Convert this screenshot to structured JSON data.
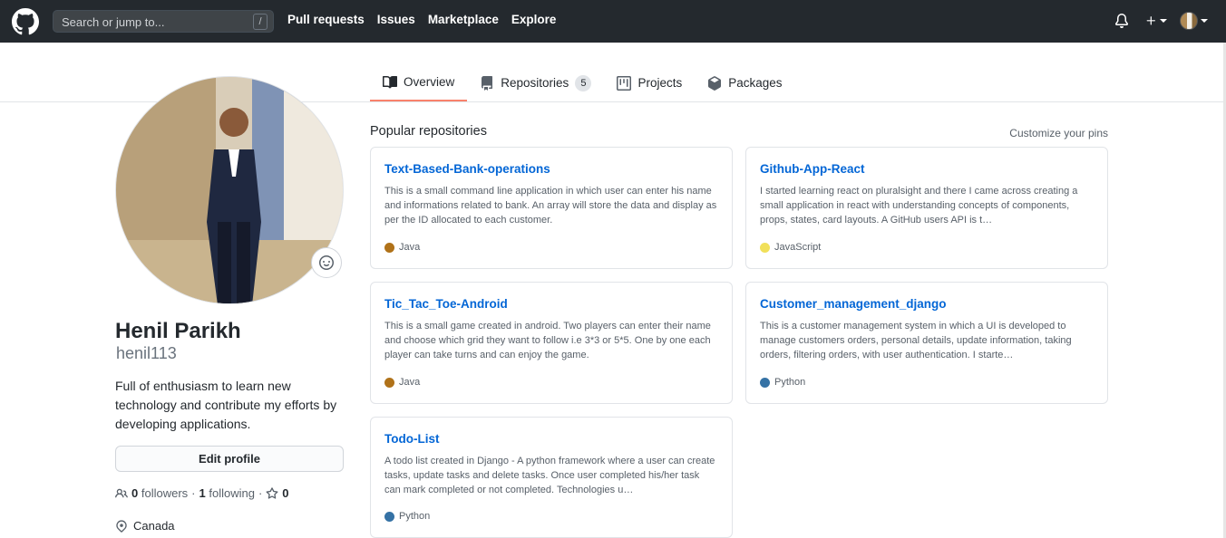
{
  "header": {
    "search_placeholder": "Search or jump to...",
    "search_shortcut": "/",
    "nav": [
      "Pull requests",
      "Issues",
      "Marketplace",
      "Explore"
    ]
  },
  "tabs": [
    {
      "label": "Overview",
      "icon": "book-icon",
      "active": true
    },
    {
      "label": "Repositories",
      "icon": "repo-icon",
      "count": "5"
    },
    {
      "label": "Projects",
      "icon": "project-icon"
    },
    {
      "label": "Packages",
      "icon": "package-icon"
    }
  ],
  "profile": {
    "name": "Henil Parikh",
    "login": "henil113",
    "bio": "Full of enthusiasm to learn new technology and contribute my efforts by developing applications.",
    "edit_label": "Edit profile",
    "followers_count": "0",
    "followers_label": "followers",
    "following_count": "1",
    "following_label": "following",
    "stars_count": "0",
    "location": "Canada"
  },
  "main": {
    "popular_title": "Popular repositories",
    "customize_label": "Customize your pins",
    "repos": [
      {
        "name": "Text-Based-Bank-operations",
        "desc": "This is a small command line application in which user can enter his name and informations related to bank. An array will store the data and display as per the ID allocated to each customer.",
        "lang": "Java",
        "lang_color": "#b07219"
      },
      {
        "name": "Github-App-React",
        "desc": "I started learning react on pluralsight and there I came across creating a small application in react with understanding concepts of components, props, states, card layouts. A GitHub users API is t…",
        "lang": "JavaScript",
        "lang_color": "#f1e05a"
      },
      {
        "name": "Tic_Tac_Toe-Android",
        "desc": "This is a small game created in android. Two players can enter their name and choose which grid they want to follow i.e 3*3 or 5*5. One by one each player can take turns and can enjoy the game.",
        "lang": "Java",
        "lang_color": "#b07219"
      },
      {
        "name": "Customer_management_django",
        "desc": "This is a customer management system in which a UI is developed to manage customers orders, personal details, update information, taking orders, filtering orders, with user authentication. I starte…",
        "lang": "Python",
        "lang_color": "#3572A5"
      },
      {
        "name": "Todo-List",
        "desc": "A todo list created in Django - A python framework where a user can create tasks, update tasks and delete tasks. Once user completed his/her task can mark completed or not completed. Technologies u…",
        "lang": "Python",
        "lang_color": "#3572A5"
      }
    ]
  }
}
